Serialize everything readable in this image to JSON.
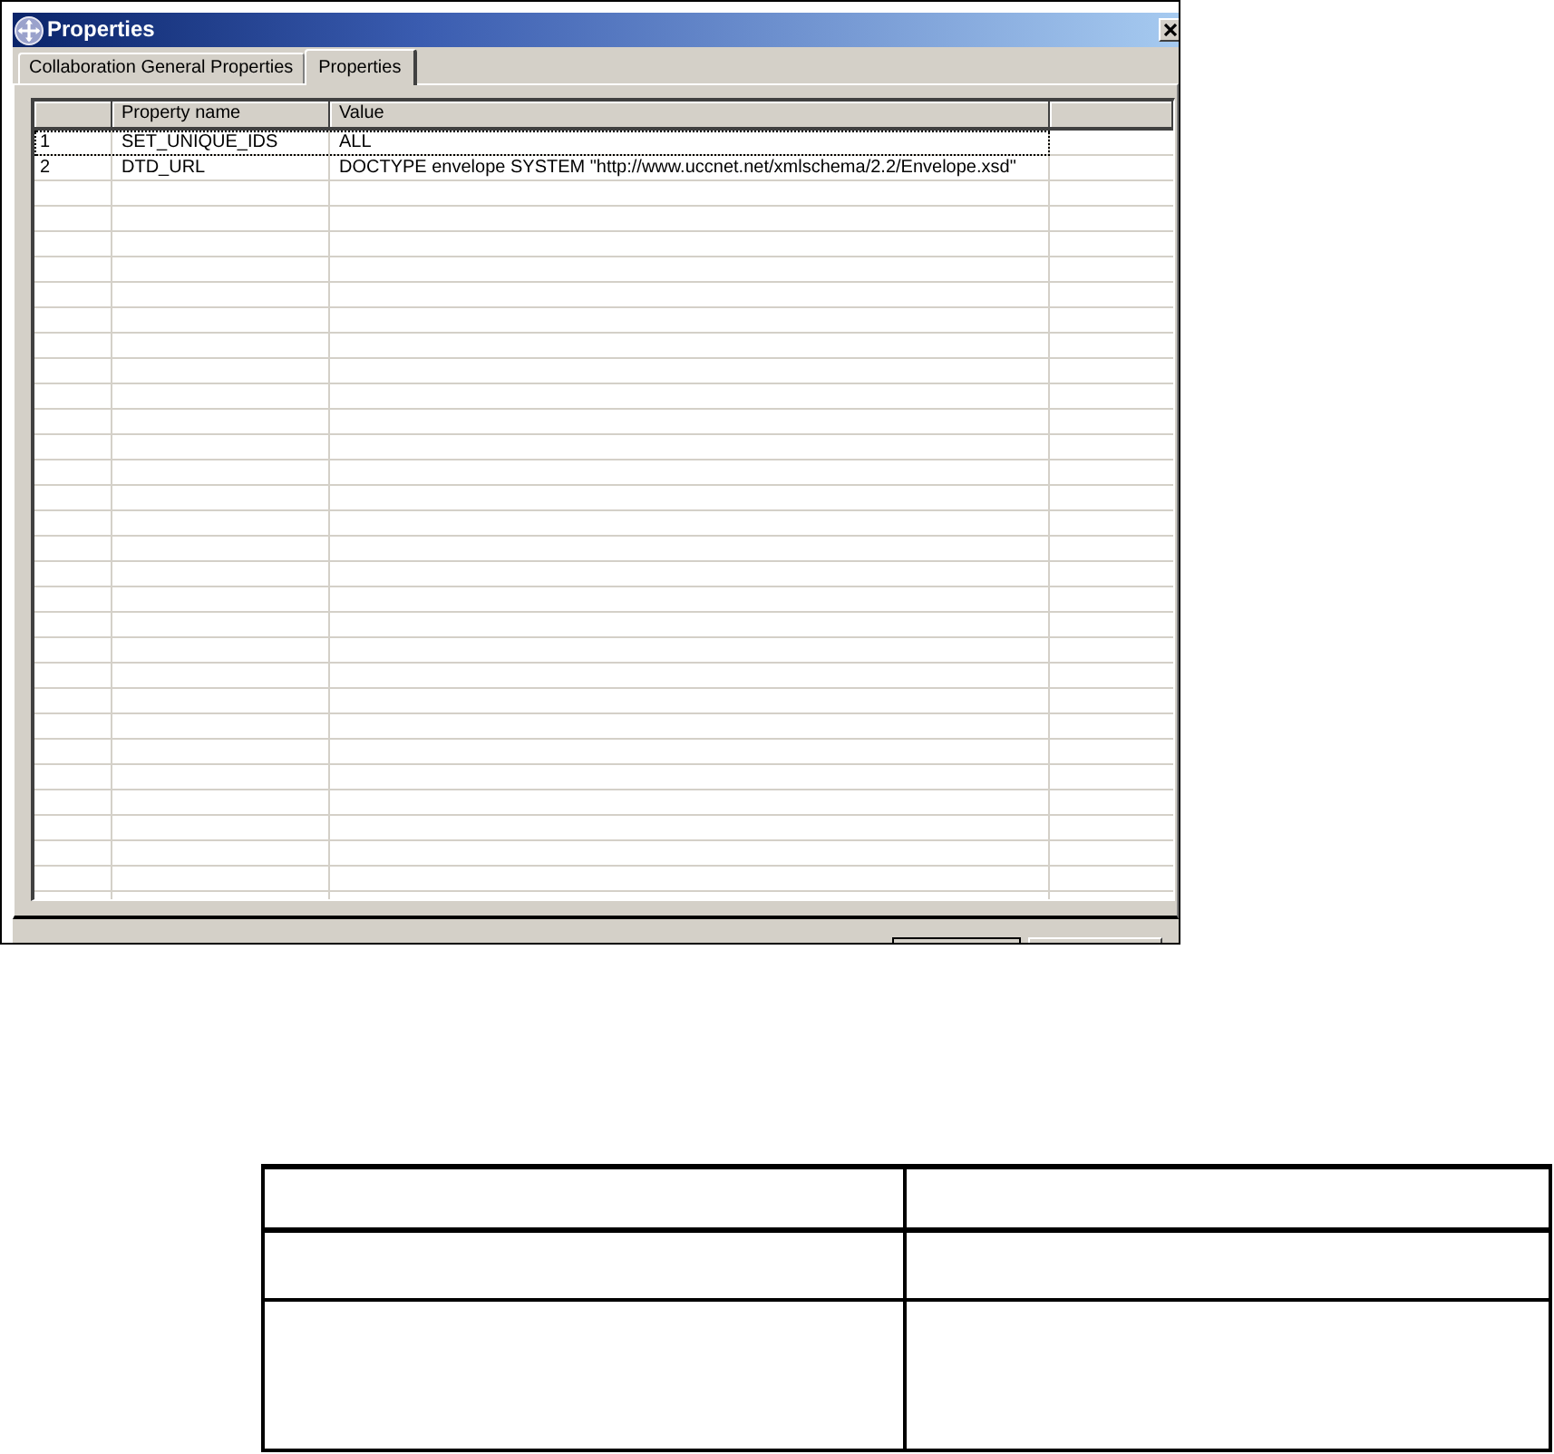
{
  "window": {
    "title": "Properties"
  },
  "tabs": [
    {
      "label": "Collaboration General Properties",
      "selected": false
    },
    {
      "label": "Properties",
      "selected": true
    }
  ],
  "table": {
    "columns": [
      {
        "kind": "index"
      },
      {
        "kind": "text",
        "label": "Property name"
      },
      {
        "kind": "text",
        "label": "Value"
      },
      {
        "kind": "filler"
      }
    ],
    "rows": [
      {
        "index": "1",
        "property": "SET_UNIQUE_IDS",
        "value": "ALL",
        "focused": true
      },
      {
        "index": "2",
        "property": "DTD_URL",
        "value": "DOCTYPE envelope SYSTEM \"http://www.uccnet.net/xmlschema/2.2/Envelope.xsd\"",
        "focused": false
      }
    ]
  },
  "footer": {
    "buttons": [
      {
        "kind": "default"
      },
      {
        "kind": "normal"
      }
    ]
  },
  "lower_table": {
    "rows": [
      {
        "kind": "header"
      },
      {
        "kind": "body"
      },
      {
        "kind": "tall"
      }
    ]
  }
}
